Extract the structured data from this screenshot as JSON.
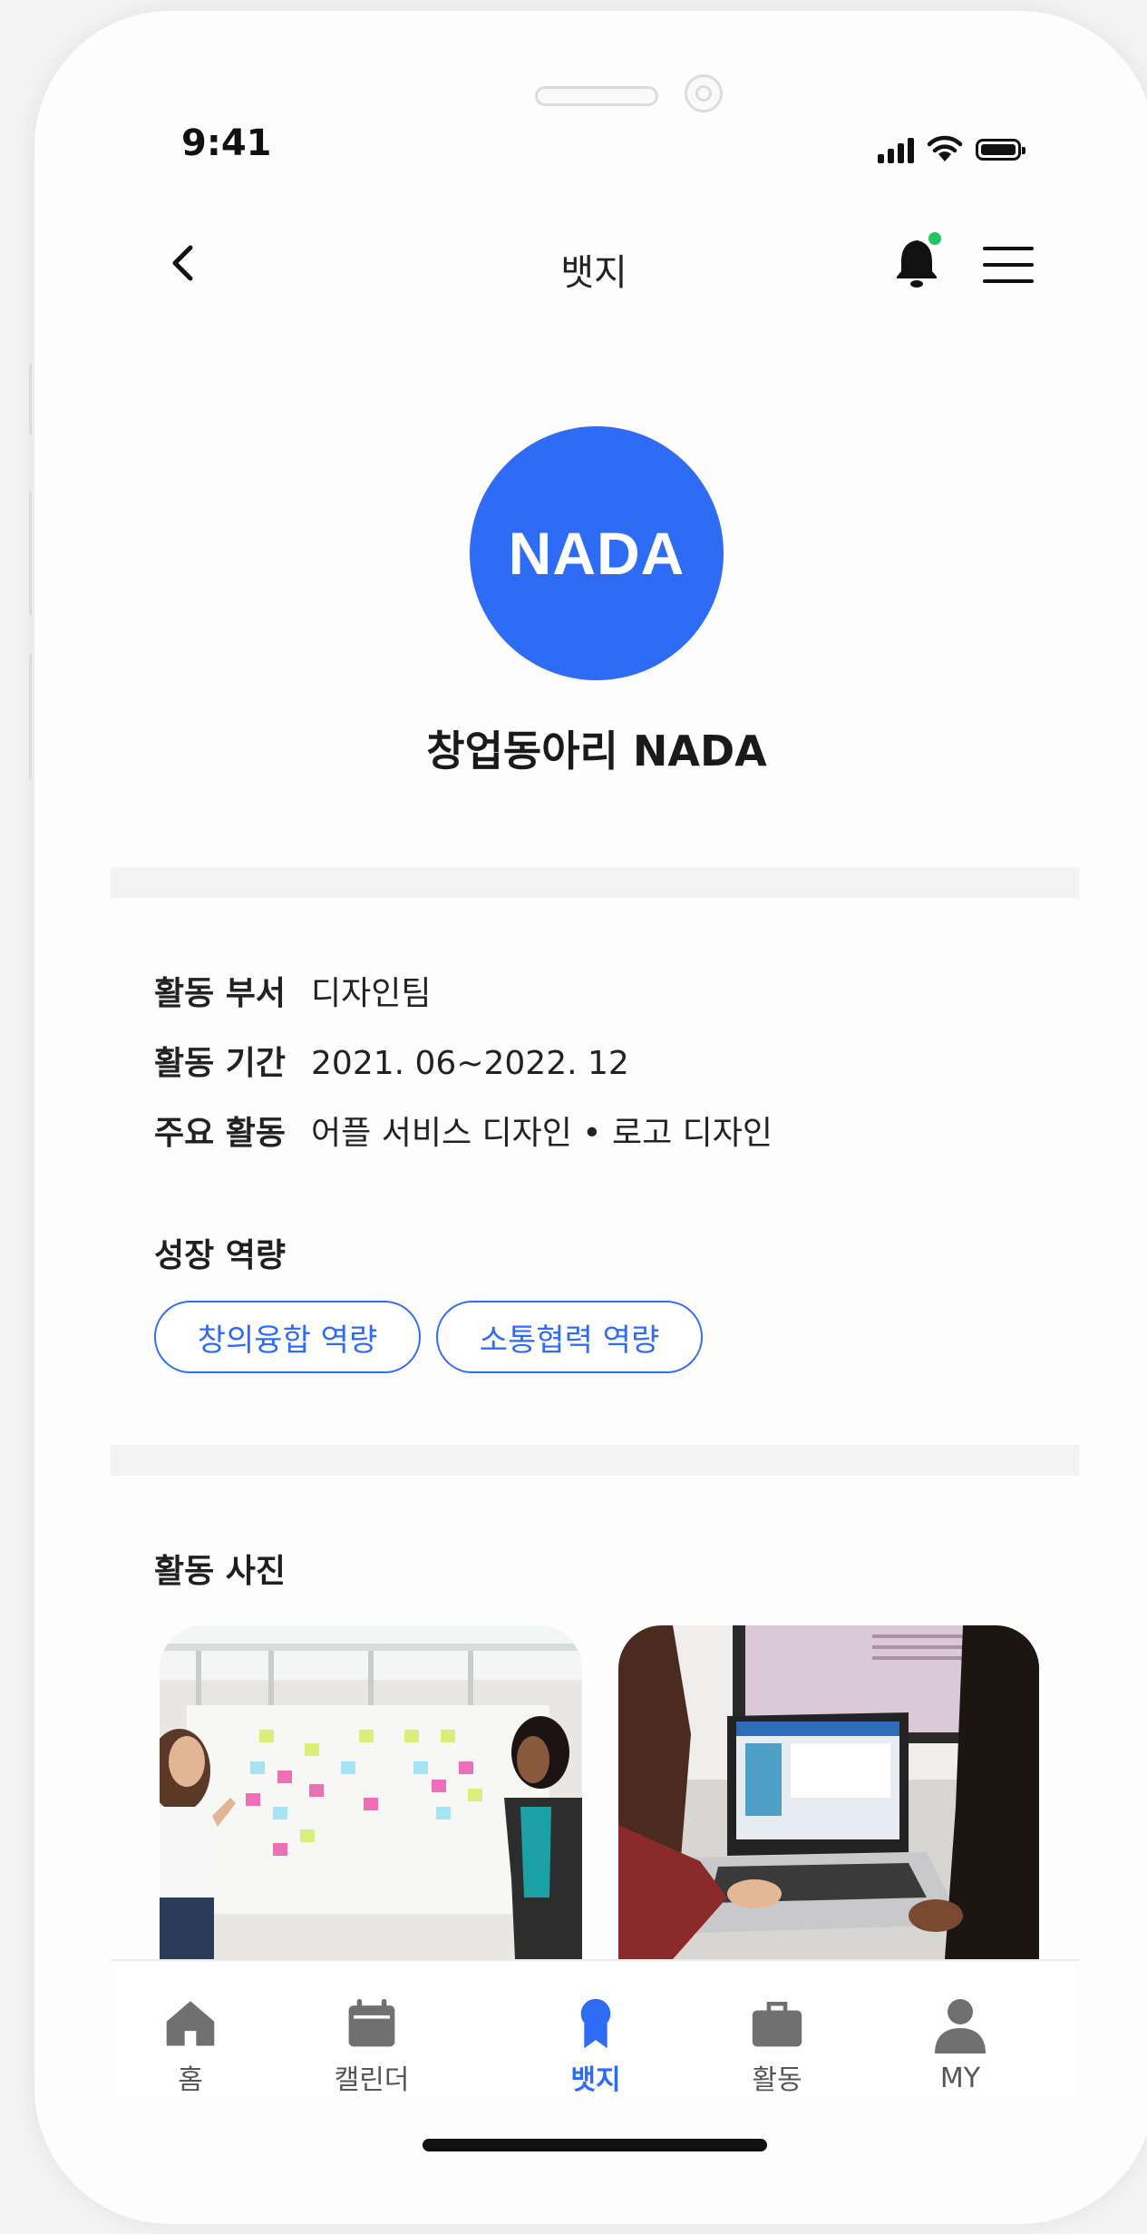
{
  "status_bar": {
    "time": "9:41"
  },
  "header": {
    "title": "뱃지",
    "notification_dot_color": "#22c55e"
  },
  "badge": {
    "logo_text": "NADA",
    "name": "창업동아리 NADA",
    "brand_color": "#2f6cf6"
  },
  "info": [
    {
      "label": "활동 부서",
      "value": "디자인팀"
    },
    {
      "label": "활동 기간",
      "value": "2021. 06~2022. 12"
    },
    {
      "label": "주요 활동",
      "value": "어플 서비스 디자인 • 로고 디자인"
    }
  ],
  "growth": {
    "title": "성장 역량",
    "chips": [
      "창의융합 역량",
      "소통협력 역량"
    ]
  },
  "photos": {
    "title": "활동 사진",
    "items": [
      "whiteboard-meeting-photo",
      "laptop-work-photo"
    ]
  },
  "tabbar": {
    "items": [
      {
        "label": "홈",
        "icon": "home-icon"
      },
      {
        "label": "캘린더",
        "icon": "calendar-icon"
      },
      {
        "label": "뱃지",
        "icon": "badge-icon",
        "active": true
      },
      {
        "label": "활동",
        "icon": "briefcase-icon"
      },
      {
        "label": "MY",
        "icon": "user-icon"
      }
    ]
  }
}
